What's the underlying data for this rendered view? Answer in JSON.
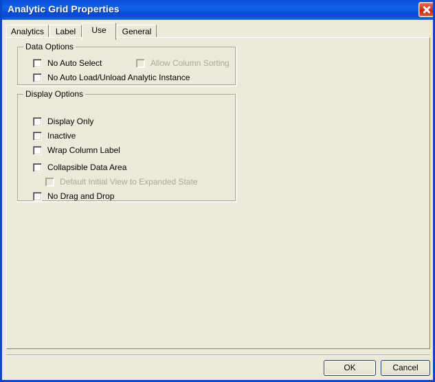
{
  "window": {
    "title": "Analytic Grid Properties",
    "close_icon": "close-icon"
  },
  "tabs": [
    {
      "label": "Analytics",
      "selected": false
    },
    {
      "label": "Label",
      "selected": false
    },
    {
      "label": "Use",
      "selected": true
    },
    {
      "label": "General",
      "selected": false
    }
  ],
  "groups": {
    "data_options": {
      "label": "Data Options",
      "checkboxes": [
        {
          "label": "No Auto Select",
          "checked": false,
          "disabled": false
        },
        {
          "label": "Allow Column Sorting",
          "checked": false,
          "disabled": true
        },
        {
          "label": "No Auto Load/Unload Analytic Instance",
          "checked": false,
          "disabled": false
        }
      ]
    },
    "display_options": {
      "label": "Display Options",
      "checkboxes": [
        {
          "label": "Display Only",
          "checked": false,
          "disabled": false
        },
        {
          "label": "Inactive",
          "checked": false,
          "disabled": false
        },
        {
          "label": "Wrap Column Label",
          "checked": false,
          "disabled": false
        },
        {
          "label": "Collapsible Data Area",
          "checked": false,
          "disabled": false
        },
        {
          "label": "Default Initial View to Expanded State",
          "checked": false,
          "disabled": true
        },
        {
          "label": "No Drag and Drop",
          "checked": false,
          "disabled": false
        }
      ]
    }
  },
  "footer": {
    "ok_label": "OK",
    "cancel_label": "Cancel"
  },
  "colors": {
    "dialog_background": "#ECE9D8",
    "title_bar_blue": "#0A51D6",
    "window_border": "#0A46C8",
    "disabled_text": "#ACA899",
    "group_border": "#ACA899",
    "close_button_red": "#D63B1F"
  }
}
